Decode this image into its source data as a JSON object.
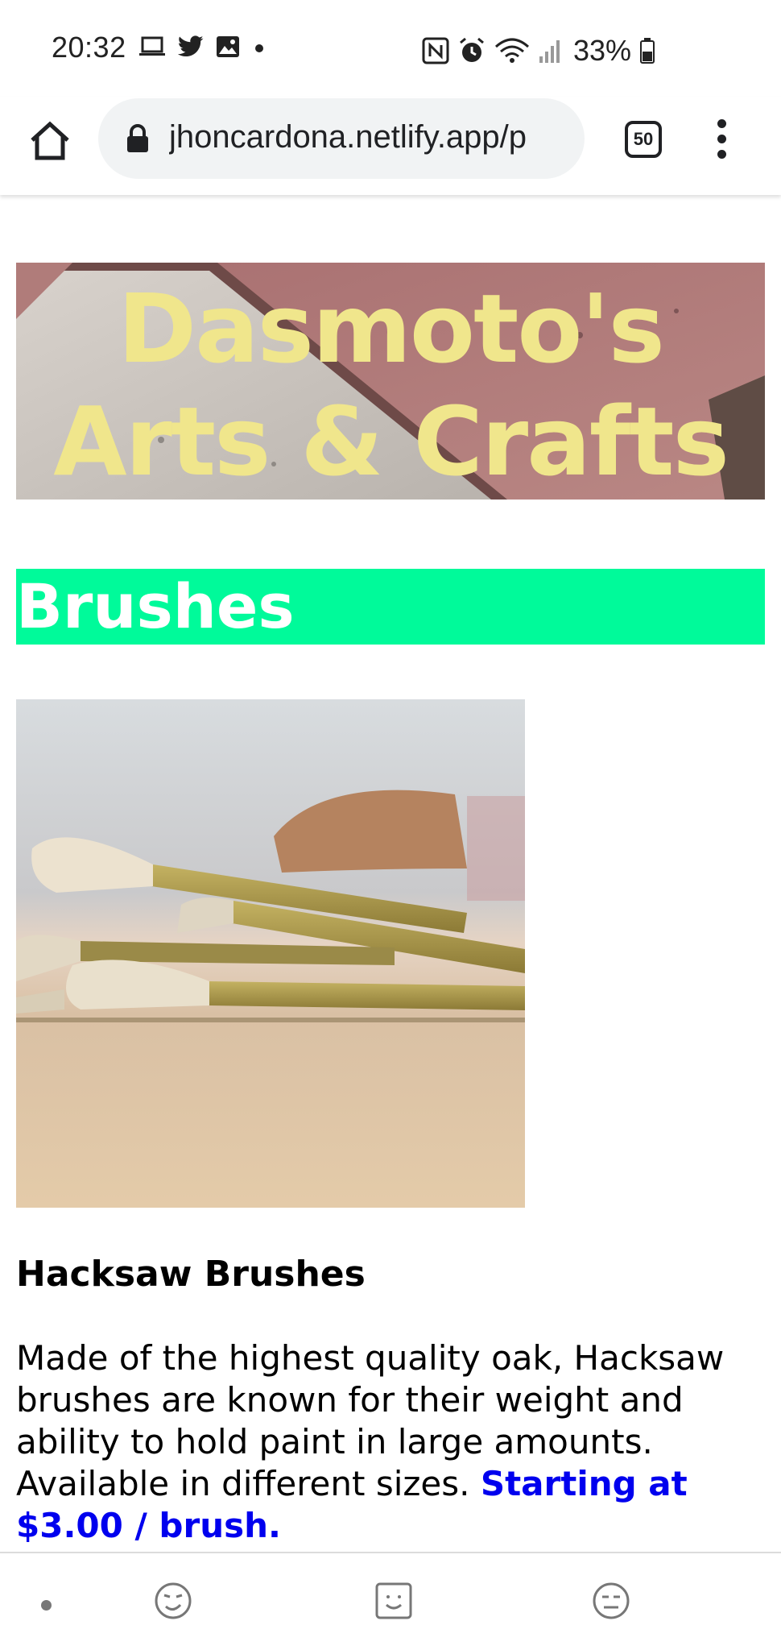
{
  "status_bar": {
    "time": "20:32",
    "left_icons": [
      "laptop-icon",
      "twitter-icon",
      "image-icon",
      "dot-icon"
    ],
    "right_icons": [
      "nfc-icon",
      "alarm-icon",
      "wifi-icon",
      "signal-icon",
      "battery-icon"
    ],
    "battery": "33%"
  },
  "browser": {
    "url": "jhoncardona.netlify.app/p",
    "tab_count": "50"
  },
  "page": {
    "banner_title": "Dasmoto's Arts & Crafts",
    "section_heading": "Brushes",
    "product": {
      "title": "Hacksaw Brushes",
      "description": "Made of the highest quality oak, Hacksaw brushes are known for their weight and ability to hold paint in large amounts. Available in different sizes.",
      "price": "Starting at $3.00 / brush."
    }
  },
  "colors": {
    "banner_text": "#f0e68c",
    "section_bg": "#00fa9a",
    "price_text": "#0000ee"
  },
  "bottom_nav": {
    "icons": [
      "dot-icon",
      "smile-face-icon",
      "emoji-square-icon",
      "bored-face-icon"
    ]
  }
}
